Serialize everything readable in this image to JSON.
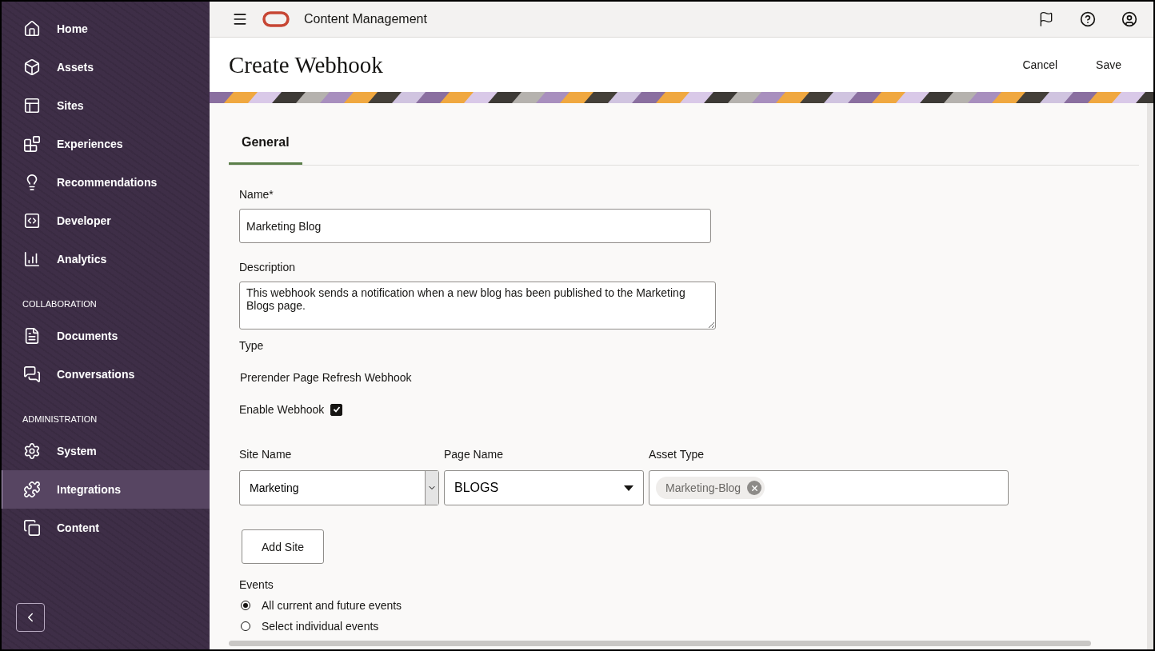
{
  "sidebar": {
    "sections": [
      {
        "items": [
          {
            "label": "Home",
            "selected": false
          },
          {
            "label": "Assets",
            "selected": false
          },
          {
            "label": "Sites",
            "selected": false
          },
          {
            "label": "Experiences",
            "selected": false
          },
          {
            "label": "Recommendations",
            "selected": false
          },
          {
            "label": "Developer",
            "selected": false
          },
          {
            "label": "Analytics",
            "selected": false
          }
        ]
      },
      {
        "heading": "COLLABORATION",
        "items": [
          {
            "label": "Documents",
            "selected": false
          },
          {
            "label": "Conversations",
            "selected": false
          }
        ]
      },
      {
        "heading": "ADMINISTRATION",
        "items": [
          {
            "label": "System",
            "selected": false
          },
          {
            "label": "Integrations",
            "selected": true
          },
          {
            "label": "Content",
            "selected": false
          }
        ]
      }
    ]
  },
  "topbar": {
    "title": "Content Management"
  },
  "header": {
    "title": "Create Webhook",
    "actions": [
      "Cancel",
      "Save"
    ]
  },
  "tabs": [
    {
      "label": "General",
      "selected": true
    }
  ],
  "form": {
    "name": {
      "label": "Name*",
      "value": "Marketing Blog"
    },
    "description": {
      "label": "Description",
      "value": "This webhook sends a notification when a new blog has been published to the Marketing Blogs page."
    },
    "type": {
      "label": "Type",
      "value": "Prerender Page Refresh Webhook"
    },
    "enable": {
      "label": "Enable Webhook",
      "checked": true
    },
    "site": {
      "site_name": {
        "label": "Site Name",
        "value": "Marketing"
      },
      "page_name": {
        "label": "Page Name",
        "value": "BLOGS"
      },
      "asset_type": {
        "label": "Asset Type",
        "tags": [
          "Marketing-Blog"
        ]
      }
    },
    "add_site": "Add Site",
    "events": {
      "label": "Events",
      "options": [
        {
          "label": "All current and future events",
          "selected": true
        },
        {
          "label": "Select individual events",
          "selected": false
        }
      ]
    }
  }
}
